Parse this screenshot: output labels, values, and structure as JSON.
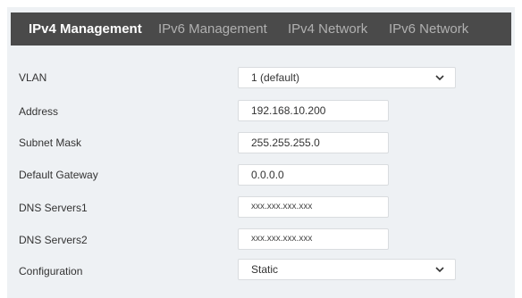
{
  "tabs": [
    {
      "label": "IPv4 Management"
    },
    {
      "label": "IPv6 Management"
    },
    {
      "label": "IPv4 Network"
    },
    {
      "label": "IPv6 Network"
    }
  ],
  "form": {
    "vlan": {
      "label": "VLAN",
      "value": "1 (default)"
    },
    "address": {
      "label": "Address",
      "value": "192.168.10.200"
    },
    "subnet_mask": {
      "label": "Subnet Mask",
      "value": "255.255.255.0"
    },
    "default_gateway": {
      "label": "Default Gateway",
      "value": "0.0.0.0"
    },
    "dns_servers1": {
      "label": "DNS Servers1",
      "placeholder": "xxx.xxx.xxx.xxx"
    },
    "dns_servers2": {
      "label": "DNS Servers2",
      "placeholder": "xxx.xxx.xxx.xxx"
    },
    "configuration": {
      "label": "Configuration",
      "value": "Static"
    }
  },
  "icons": {
    "dropdown": "chevron-down-icon"
  },
  "colors": {
    "tab_bar": "#4a4a4a",
    "panel": "#eef1f4",
    "active_tab_text": "#ffffff",
    "inactive_tab_text": "#b0b0b0"
  }
}
